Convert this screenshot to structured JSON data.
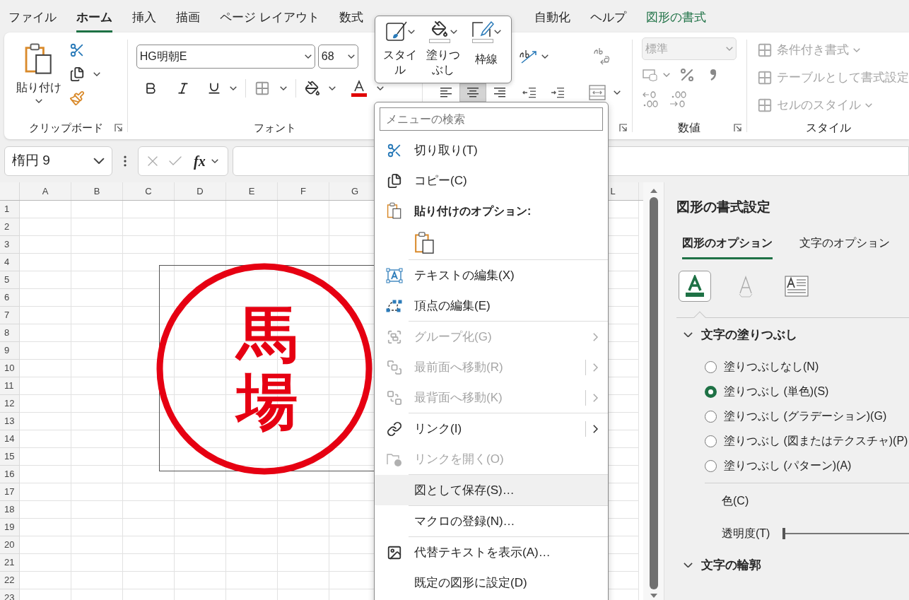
{
  "ribbon_tabs": [
    {
      "label": "ファイル",
      "selected": false,
      "kind": "standard"
    },
    {
      "label": "ホーム",
      "selected": true,
      "kind": "standard"
    },
    {
      "label": "挿入",
      "selected": false,
      "kind": "standard"
    },
    {
      "label": "描画",
      "selected": false,
      "kind": "standard"
    },
    {
      "label": "ページ レイアウト",
      "selected": false,
      "kind": "standard"
    },
    {
      "label": "数式",
      "selected": false,
      "kind": "standard"
    },
    {
      "label": "自動化",
      "selected": false,
      "kind": "standard"
    },
    {
      "label": "ヘルプ",
      "selected": false,
      "kind": "standard"
    },
    {
      "label": "図形の書式",
      "selected": false,
      "kind": "contextual"
    }
  ],
  "clipboard": {
    "paste_label": "貼り付け",
    "group_label": "クリップボード"
  },
  "font": {
    "font_name": "HG明朝E",
    "font_size": "68",
    "group_label": "フォント"
  },
  "alignment": {
    "align_buttons": [
      {
        "selected": false
      },
      {
        "selected": true
      },
      {
        "selected": false
      }
    ]
  },
  "number": {
    "format": "標準",
    "format_disabled": true,
    "group_label": "数値"
  },
  "styles": {
    "disabled": true,
    "group_label": "スタイル",
    "items": [
      {
        "label": "条件付き書式",
        "dropdown": true
      },
      {
        "label": "テーブルとして書式設定",
        "dropdown": false
      },
      {
        "label": "セルのスタイル",
        "dropdown": true
      }
    ]
  },
  "mini_toolbar": {
    "buttons": [
      {
        "label": "スタイル"
      },
      {
        "label": "塗りつぶし"
      },
      {
        "label": "枠線"
      }
    ]
  },
  "formula_bar": {
    "name_box": "楕円 9",
    "function_label": "fx"
  },
  "sheet": {
    "columns_left": [
      "A",
      "B",
      "C",
      "D",
      "E",
      "F",
      "G"
    ],
    "columns_right": [
      "L"
    ],
    "rows": [
      "1",
      "2",
      "3",
      "4",
      "5",
      "6",
      "7",
      "8",
      "9",
      "10",
      "11",
      "12",
      "13",
      "14",
      "15",
      "16",
      "17",
      "18",
      "19",
      "20",
      "21",
      "22",
      "23"
    ],
    "stamp": {
      "text": "馬場"
    }
  },
  "context_menu": {
    "search_placeholder": "メニューの検索",
    "items": [
      {
        "kind": "item",
        "label": "切り取り(T)",
        "disabled": false,
        "highlighted": false,
        "submenu": false,
        "split": false
      },
      {
        "kind": "item",
        "label": "コピー(C)",
        "disabled": false,
        "highlighted": false,
        "submenu": false,
        "split": false
      },
      {
        "kind": "header",
        "label": "貼り付けのオプション:"
      },
      {
        "kind": "paste-options"
      },
      {
        "kind": "separator"
      },
      {
        "kind": "item",
        "label": "テキストの編集(X)",
        "disabled": false,
        "highlighted": false,
        "submenu": false,
        "split": false
      },
      {
        "kind": "item",
        "label": "頂点の編集(E)",
        "disabled": false,
        "highlighted": false,
        "submenu": false,
        "split": false
      },
      {
        "kind": "separator"
      },
      {
        "kind": "item",
        "label": "グループ化(G)",
        "disabled": true,
        "highlighted": false,
        "submenu": true,
        "split": false
      },
      {
        "kind": "item",
        "label": "最前面へ移動(R)",
        "disabled": true,
        "highlighted": false,
        "submenu": true,
        "split": true
      },
      {
        "kind": "item",
        "label": "最背面へ移動(K)",
        "disabled": true,
        "highlighted": false,
        "submenu": true,
        "split": true
      },
      {
        "kind": "separator"
      },
      {
        "kind": "item",
        "label": "リンク(I)",
        "disabled": false,
        "highlighted": false,
        "submenu": true,
        "split": true
      },
      {
        "kind": "item",
        "label": "リンクを開く(O)",
        "disabled": true,
        "highlighted": false,
        "submenu": false,
        "split": false
      },
      {
        "kind": "separator"
      },
      {
        "kind": "item",
        "label": "図として保存(S)…",
        "disabled": false,
        "highlighted": true,
        "submenu": false,
        "split": false
      },
      {
        "kind": "separator"
      },
      {
        "kind": "item",
        "label": "マクロの登録(N)…",
        "disabled": false,
        "highlighted": false,
        "submenu": false,
        "split": false
      },
      {
        "kind": "separator"
      },
      {
        "kind": "item",
        "label": "代替テキストを表示(A)…",
        "disabled": false,
        "highlighted": false,
        "submenu": false,
        "split": false
      },
      {
        "kind": "item",
        "label": "既定の図形に設定(D)",
        "disabled": false,
        "highlighted": false,
        "submenu": false,
        "split": false
      }
    ]
  },
  "format_pane": {
    "title": "図形の書式設定",
    "tabs": [
      {
        "label": "図形のオプション",
        "selected": true
      },
      {
        "label": "文字のオプション",
        "selected": false
      }
    ],
    "icon_tabs": [
      {
        "selected": true
      },
      {
        "selected": false
      },
      {
        "selected": false
      }
    ],
    "sections": [
      {
        "title": "文字の塗りつぶし",
        "expanded": true,
        "options": [
          {
            "label": "塗りつぶしなし(N)",
            "selected": false
          },
          {
            "label": "塗りつぶし (単色)(S)",
            "selected": true
          },
          {
            "label": "塗りつぶし (グラデーション)(G)",
            "selected": false
          },
          {
            "label": "塗りつぶし (図またはテクスチャ)(P)",
            "selected": false
          },
          {
            "label": "塗りつぶし (パターン)(A)",
            "selected": false
          }
        ],
        "color_label": "色(C)",
        "transparency": {
          "label": "透明度(T)",
          "level": 0
        }
      },
      {
        "title": "文字の輪郭",
        "expanded": true
      }
    ]
  }
}
